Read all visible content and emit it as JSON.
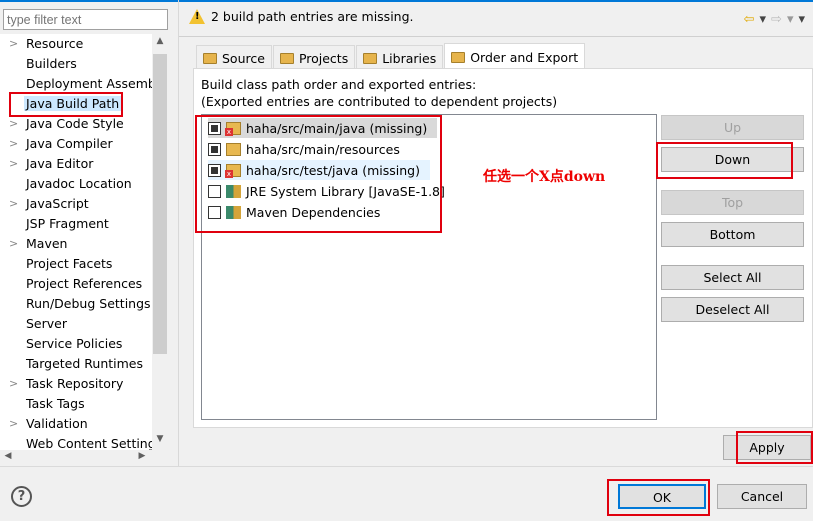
{
  "filter": {
    "placeholder": "type filter text"
  },
  "tree": [
    {
      "label": "Resource",
      "expandable": true
    },
    {
      "label": "Builders",
      "expandable": false
    },
    {
      "label": "Deployment Assembly",
      "expandable": false
    },
    {
      "label": "Java Build Path",
      "expandable": false,
      "selected": true
    },
    {
      "label": "Java Code Style",
      "expandable": true
    },
    {
      "label": "Java Compiler",
      "expandable": true
    },
    {
      "label": "Java Editor",
      "expandable": true
    },
    {
      "label": "Javadoc Location",
      "expandable": false
    },
    {
      "label": "JavaScript",
      "expandable": true
    },
    {
      "label": "JSP Fragment",
      "expandable": false
    },
    {
      "label": "Maven",
      "expandable": true
    },
    {
      "label": "Project Facets",
      "expandable": false
    },
    {
      "label": "Project References",
      "expandable": false
    },
    {
      "label": "Run/Debug Settings",
      "expandable": false
    },
    {
      "label": "Server",
      "expandable": false
    },
    {
      "label": "Service Policies",
      "expandable": false
    },
    {
      "label": "Targeted Runtimes",
      "expandable": false
    },
    {
      "label": "Task Repository",
      "expandable": true
    },
    {
      "label": "Task Tags",
      "expandable": false
    },
    {
      "label": "Validation",
      "expandable": true
    },
    {
      "label": "Web Content Settings",
      "expandable": false
    }
  ],
  "header": {
    "warning": "2 build path entries are missing."
  },
  "tabs": [
    {
      "label": "Source"
    },
    {
      "label": "Projects"
    },
    {
      "label": "Libraries"
    },
    {
      "label": "Order and Export",
      "active": true
    }
  ],
  "description": {
    "line1": "Build class path order and exported entries:",
    "line2": "(Exported entries are contributed to dependent projects)"
  },
  "entries": [
    {
      "label": "haha/src/main/java (missing)",
      "checked": true,
      "icon": "source-folder-missing",
      "highlight": "#d9d9d9"
    },
    {
      "label": "haha/src/main/resources",
      "checked": true,
      "icon": "source-folder"
    },
    {
      "label": "haha/src/test/java (missing)",
      "checked": true,
      "icon": "source-folder-missing",
      "highlight": "#e5f3ff"
    },
    {
      "label": "JRE System Library [JavaSE-1.8]",
      "checked": false,
      "icon": "library"
    },
    {
      "label": "Maven Dependencies",
      "checked": false,
      "icon": "library"
    }
  ],
  "buttons": {
    "up": "Up",
    "down": "Down",
    "top": "Top",
    "bottom": "Bottom",
    "select_all": "Select All",
    "deselect_all": "Deselect All",
    "apply": "Apply",
    "ok": "OK",
    "cancel": "Cancel"
  },
  "annotation": {
    "note": "任选一个X点down",
    "color": "#e0000e"
  }
}
